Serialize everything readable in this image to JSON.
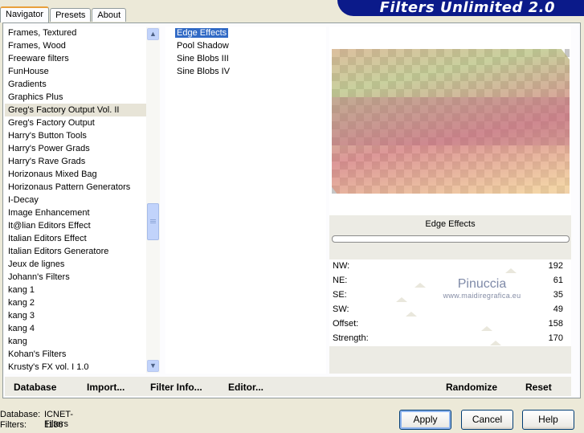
{
  "tabs": [
    {
      "label": "Navigator",
      "active": true
    },
    {
      "label": "Presets",
      "active": false
    },
    {
      "label": "About",
      "active": false
    }
  ],
  "banner": {
    "title": "Filters Unlimited 2.0",
    "color": "#0b1a8a"
  },
  "categories": [
    "Frames, Textured",
    "Frames, Wood",
    "Freeware filters",
    "FunHouse",
    "Gradients",
    "Graphics Plus",
    "Greg's Factory Output Vol. II",
    "Greg's Factory Output",
    "Harry's Button Tools",
    "Harry's Power Grads",
    "Harry's Rave Grads",
    "Horizonaus Mixed Bag",
    "Horizonaus Pattern Generators",
    "I-Decay",
    "Image Enhancement",
    "It@lian Editors Effect",
    "Italian Editors Effect",
    "Italian Editors Generatore",
    "Jeux de lignes",
    "Johann's Filters",
    "kang 1",
    "kang 2",
    "kang 3",
    "kang 4",
    "kang",
    "Kohan's Filters",
    "Krusty's FX vol. I 1.0"
  ],
  "selected_category": "Greg's Factory Output Vol. II",
  "filters": [
    "Edge Effects",
    "Pool Shadow",
    "Sine Blobs III",
    "Sine Blobs IV"
  ],
  "selected_filter": "Edge Effects",
  "preview": {
    "filter_name": "Edge Effects"
  },
  "params": [
    {
      "label": "NW:",
      "value": "192",
      "level": 0.753
    },
    {
      "label": "NE:",
      "value": "61",
      "level": 0.239
    },
    {
      "label": "SE:",
      "value": "35",
      "level": 0.137
    },
    {
      "label": "SW:",
      "value": "49",
      "level": 0.192
    },
    {
      "label": "Offset:",
      "value": "158",
      "level": 0.62
    },
    {
      "label": "Strength:",
      "value": "170",
      "level": 0.667
    }
  ],
  "watermark": {
    "name": "Pinuccia",
    "url": "www.maidiregrafica.eu"
  },
  "bottom_buttons": {
    "database": "Database",
    "import": "Import...",
    "filter_info": "Filter Info...",
    "editor": "Editor...",
    "randomize": "Randomize",
    "reset": "Reset"
  },
  "status": {
    "database_label": "Database:",
    "database_value": "ICNET-Filters",
    "filters_label": "Filters:",
    "filters_value": "1186"
  },
  "dialog_buttons": {
    "apply": "Apply",
    "cancel": "Cancel",
    "help": "Help"
  },
  "colors": {
    "selection": "#316ac5",
    "dialog_bg": "#ece9d8"
  }
}
